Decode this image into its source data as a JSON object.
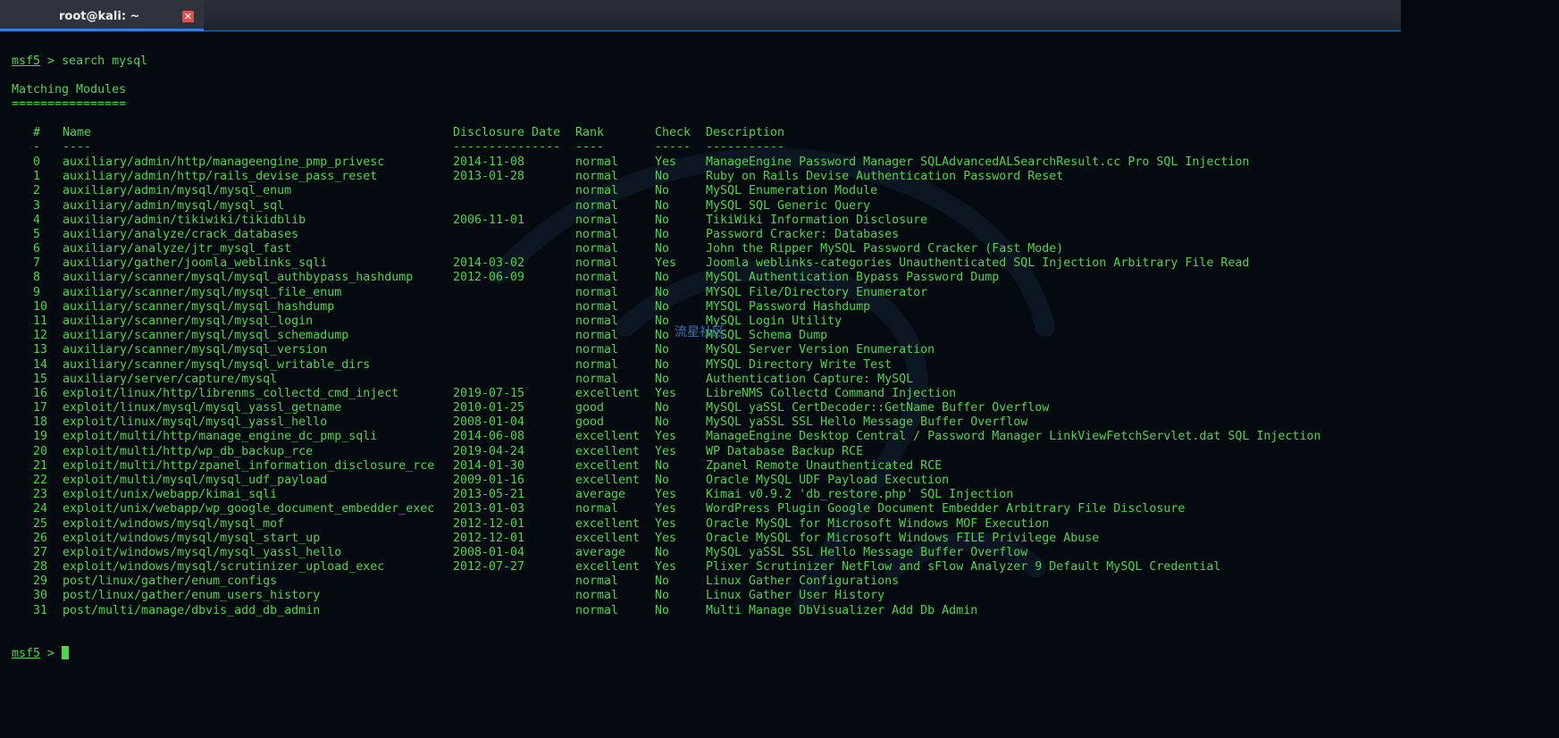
{
  "window": {
    "tab_title": "root@kali: ~",
    "close_glyph": "✕"
  },
  "terminal": {
    "prompt": "msf5",
    "prompt_sep": " > ",
    "command": "search mysql",
    "heading": "Matching Modules",
    "heading_rule": "================",
    "columns": {
      "num": "#",
      "name": "Name",
      "date": "Disclosure Date",
      "rank": "Rank",
      "check": "Check",
      "desc": "Description"
    },
    "separators": {
      "num": "-",
      "name": "----",
      "date": "---------------",
      "rank": "----",
      "check": "-----",
      "desc": "-----------"
    },
    "modules": [
      {
        "num": "0",
        "name": "auxiliary/admin/http/manageengine_pmp_privesc",
        "date": "2014-11-08",
        "rank": "normal",
        "check": "Yes",
        "desc": "ManageEngine Password Manager SQLAdvancedALSearchResult.cc Pro SQL Injection"
      },
      {
        "num": "1",
        "name": "auxiliary/admin/http/rails_devise_pass_reset",
        "date": "2013-01-28",
        "rank": "normal",
        "check": "No",
        "desc": "Ruby on Rails Devise Authentication Password Reset"
      },
      {
        "num": "2",
        "name": "auxiliary/admin/mysql/mysql_enum",
        "date": "",
        "rank": "normal",
        "check": "No",
        "desc": "MySQL Enumeration Module"
      },
      {
        "num": "3",
        "name": "auxiliary/admin/mysql/mysql_sql",
        "date": "",
        "rank": "normal",
        "check": "No",
        "desc": "MySQL SQL Generic Query"
      },
      {
        "num": "4",
        "name": "auxiliary/admin/tikiwiki/tikidblib",
        "date": "2006-11-01",
        "rank": "normal",
        "check": "No",
        "desc": "TikiWiki Information Disclosure"
      },
      {
        "num": "5",
        "name": "auxiliary/analyze/crack_databases",
        "date": "",
        "rank": "normal",
        "check": "No",
        "desc": "Password Cracker: Databases"
      },
      {
        "num": "6",
        "name": "auxiliary/analyze/jtr_mysql_fast",
        "date": "",
        "rank": "normal",
        "check": "No",
        "desc": "John the Ripper MySQL Password Cracker (Fast Mode)"
      },
      {
        "num": "7",
        "name": "auxiliary/gather/joomla_weblinks_sqli",
        "date": "2014-03-02",
        "rank": "normal",
        "check": "Yes",
        "desc": "Joomla weblinks-categories Unauthenticated SQL Injection Arbitrary File Read"
      },
      {
        "num": "8",
        "name": "auxiliary/scanner/mysql/mysql_authbypass_hashdump",
        "date": "2012-06-09",
        "rank": "normal",
        "check": "No",
        "desc": "MySQL Authentication Bypass Password Dump"
      },
      {
        "num": "9",
        "name": "auxiliary/scanner/mysql/mysql_file_enum",
        "date": "",
        "rank": "normal",
        "check": "No",
        "desc": "MYSQL File/Directory Enumerator"
      },
      {
        "num": "10",
        "name": "auxiliary/scanner/mysql/mysql_hashdump",
        "date": "",
        "rank": "normal",
        "check": "No",
        "desc": "MYSQL Password Hashdump"
      },
      {
        "num": "11",
        "name": "auxiliary/scanner/mysql/mysql_login",
        "date": "",
        "rank": "normal",
        "check": "No",
        "desc": "MySQL Login Utility"
      },
      {
        "num": "12",
        "name": "auxiliary/scanner/mysql/mysql_schemadump",
        "date": "",
        "rank": "normal",
        "check": "No",
        "desc": "MYSQL Schema Dump"
      },
      {
        "num": "13",
        "name": "auxiliary/scanner/mysql/mysql_version",
        "date": "",
        "rank": "normal",
        "check": "No",
        "desc": "MySQL Server Version Enumeration"
      },
      {
        "num": "14",
        "name": "auxiliary/scanner/mysql/mysql_writable_dirs",
        "date": "",
        "rank": "normal",
        "check": "No",
        "desc": "MYSQL Directory Write Test"
      },
      {
        "num": "15",
        "name": "auxiliary/server/capture/mysql",
        "date": "",
        "rank": "normal",
        "check": "No",
        "desc": "Authentication Capture: MySQL"
      },
      {
        "num": "16",
        "name": "exploit/linux/http/librenms_collectd_cmd_inject",
        "date": "2019-07-15",
        "rank": "excellent",
        "check": "Yes",
        "desc": "LibreNMS Collectd Command Injection"
      },
      {
        "num": "17",
        "name": "exploit/linux/mysql/mysql_yassl_getname",
        "date": "2010-01-25",
        "rank": "good",
        "check": "No",
        "desc": "MySQL yaSSL CertDecoder::GetName Buffer Overflow"
      },
      {
        "num": "18",
        "name": "exploit/linux/mysql/mysql_yassl_hello",
        "date": "2008-01-04",
        "rank": "good",
        "check": "No",
        "desc": "MySQL yaSSL SSL Hello Message Buffer Overflow"
      },
      {
        "num": "19",
        "name": "exploit/multi/http/manage_engine_dc_pmp_sqli",
        "date": "2014-06-08",
        "rank": "excellent",
        "check": "Yes",
        "desc": "ManageEngine Desktop Central / Password Manager LinkViewFetchServlet.dat SQL Injection"
      },
      {
        "num": "20",
        "name": "exploit/multi/http/wp_db_backup_rce",
        "date": "2019-04-24",
        "rank": "excellent",
        "check": "Yes",
        "desc": "WP Database Backup RCE"
      },
      {
        "num": "21",
        "name": "exploit/multi/http/zpanel_information_disclosure_rce",
        "date": "2014-01-30",
        "rank": "excellent",
        "check": "No",
        "desc": "Zpanel Remote Unauthenticated RCE"
      },
      {
        "num": "22",
        "name": "exploit/multi/mysql/mysql_udf_payload",
        "date": "2009-01-16",
        "rank": "excellent",
        "check": "No",
        "desc": "Oracle MySQL UDF Payload Execution"
      },
      {
        "num": "23",
        "name": "exploit/unix/webapp/kimai_sqli",
        "date": "2013-05-21",
        "rank": "average",
        "check": "Yes",
        "desc": "Kimai v0.9.2 'db_restore.php' SQL Injection"
      },
      {
        "num": "24",
        "name": "exploit/unix/webapp/wp_google_document_embedder_exec",
        "date": "2013-01-03",
        "rank": "normal",
        "check": "Yes",
        "desc": "WordPress Plugin Google Document Embedder Arbitrary File Disclosure"
      },
      {
        "num": "25",
        "name": "exploit/windows/mysql/mysql_mof",
        "date": "2012-12-01",
        "rank": "excellent",
        "check": "Yes",
        "desc": "Oracle MySQL for Microsoft Windows MOF Execution"
      },
      {
        "num": "26",
        "name": "exploit/windows/mysql/mysql_start_up",
        "date": "2012-12-01",
        "rank": "excellent",
        "check": "Yes",
        "desc": "Oracle MySQL for Microsoft Windows FILE Privilege Abuse"
      },
      {
        "num": "27",
        "name": "exploit/windows/mysql/mysql_yassl_hello",
        "date": "2008-01-04",
        "rank": "average",
        "check": "No",
        "desc": "MySQL yaSSL SSL Hello Message Buffer Overflow"
      },
      {
        "num": "28",
        "name": "exploit/windows/mysql/scrutinizer_upload_exec",
        "date": "2012-07-27",
        "rank": "excellent",
        "check": "Yes",
        "desc": "Plixer Scrutinizer NetFlow and sFlow Analyzer 9 Default MySQL Credential"
      },
      {
        "num": "29",
        "name": "post/linux/gather/enum_configs",
        "date": "",
        "rank": "normal",
        "check": "No",
        "desc": "Linux Gather Configurations"
      },
      {
        "num": "30",
        "name": "post/linux/gather/enum_users_history",
        "date": "",
        "rank": "normal",
        "check": "No",
        "desc": "Linux Gather User History"
      },
      {
        "num": "31",
        "name": "post/multi/manage/dbvis_add_db_admin",
        "date": "",
        "rank": "normal",
        "check": "No",
        "desc": "Multi Manage DbVisualizer Add Db Admin"
      }
    ],
    "watermark": "流星社区"
  },
  "colors": {
    "terminal_text": "#4ed64b",
    "terminal_bg": "#050a11",
    "tab_accent": "#3d7dd8",
    "close_button": "#d9544f"
  }
}
